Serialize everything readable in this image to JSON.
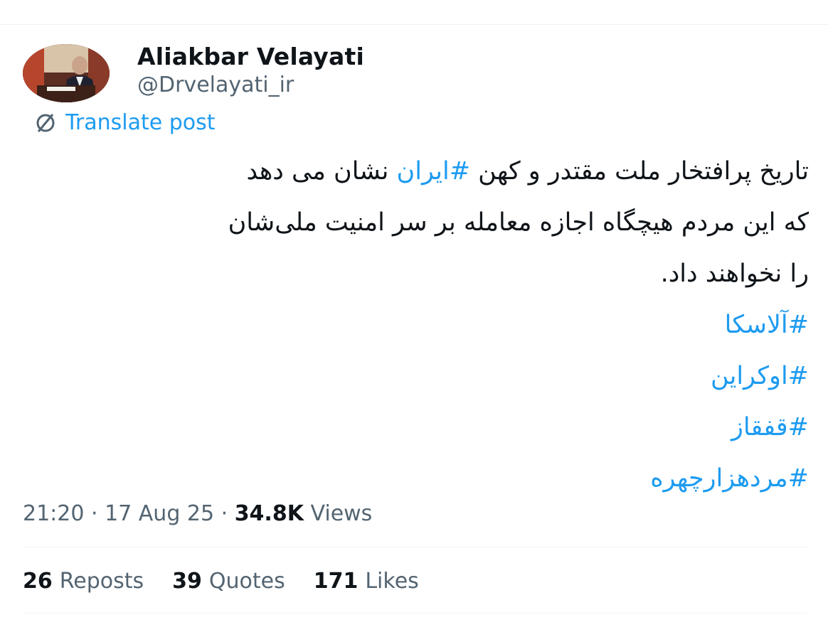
{
  "author": {
    "display_name": "Aliakbar Velayati",
    "handle": "@Drvelayati_ir",
    "avatar_icon": "profile-photo"
  },
  "translate": {
    "icon": "translate-globe-icon",
    "label": "Translate post"
  },
  "body": {
    "line1_before": "تاریخ پرافتخار ملت مقتدر و کهن ",
    "line1_hashtag": "#ایران",
    "line1_after": " نشان می دهد",
    "line2": "که این مردم هیچگاه اجازه معامله بر سر امنیت ملی‌شان",
    "line3": "را نخواهند داد.",
    "hashtags": [
      "#آلاسکا",
      "#اوکراین",
      "#قفقاز",
      "#مردهزارچهره"
    ]
  },
  "meta": {
    "time": "21:20",
    "sep1": " · ",
    "date": "17 Aug 25",
    "sep2": " · ",
    "views_count": "34.8K",
    "views_label": " Views"
  },
  "stats": {
    "reposts_count": "26",
    "reposts_label": "Reposts",
    "quotes_count": "39",
    "quotes_label": "Quotes",
    "likes_count": "171",
    "likes_label": "Likes"
  },
  "colors": {
    "accent": "#1d9bf0",
    "text": "#0f1419",
    "secondary": "#536471",
    "divider": "#eff3f4"
  }
}
